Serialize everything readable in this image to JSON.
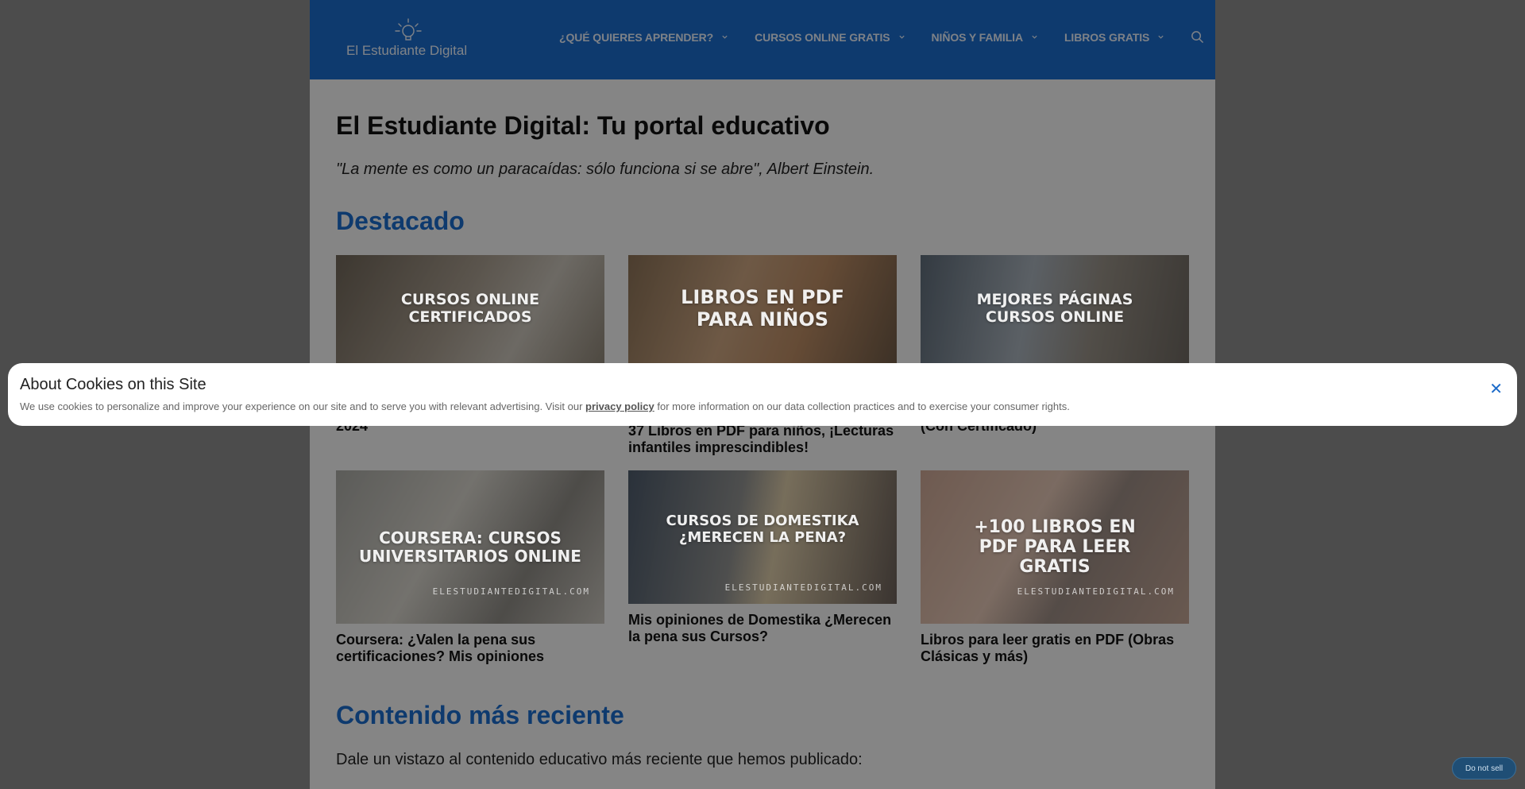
{
  "header": {
    "logo_text": "El Estudiante Digital",
    "nav": [
      {
        "label": "¿QUÉ QUIERES APRENDER?"
      },
      {
        "label": "CURSOS ONLINE GRATIS"
      },
      {
        "label": "NIÑOS Y FAMILIA"
      },
      {
        "label": "LIBROS GRATIS"
      }
    ]
  },
  "main": {
    "title": "El Estudiante Digital: Tu portal educativo",
    "quote": "\"La mente es como un paracaídas: sólo funciona si se abre\", Albert Einstein.",
    "featured_heading": "Destacado",
    "featured": [
      {
        "thumb_text": "CURSOS ONLINE CERTIFICADOS",
        "title": "2024"
      },
      {
        "thumb_text": "LIBROS EN PDF PARA NIÑOS",
        "title": "37 Libros en PDF para niños, ¡Lecturas infantiles imprescindibles!"
      },
      {
        "thumb_text": "MEJORES PÁGINAS CURSOS ONLINE",
        "title": "(Con Certificado)"
      },
      {
        "thumb_text": "COURSERA: CURSOS UNIVERSITARIOS ONLINE",
        "site": "ELESTUDIANTEDIGITAL.COM",
        "title": "Coursera: ¿Valen la pena sus certificaciones? Mis opiniones"
      },
      {
        "thumb_text": "CURSOS DE DOMESTIKA ¿MERECEN LA PENA?",
        "site": "ELESTUDIANTEDIGITAL.COM",
        "title": "Mis opiniones de Domestika ¿Merecen la pena sus Cursos?"
      },
      {
        "thumb_text": "+100 LIBROS EN PDF PARA LEER GRATIS",
        "site": "ELESTUDIANTEDIGITAL.COM",
        "title": "Libros para leer gratis en PDF (Obras Clásicas y más)"
      }
    ],
    "recent_heading": "Contenido más reciente",
    "recent_text": "Dale un vistazo al contenido educativo más reciente que hemos publicado:"
  },
  "cookie_banner": {
    "title": "About Cookies on this Site",
    "text_before": "We use cookies to personalize and improve your experience on our site and to serve you with relevant advertising. Visit our ",
    "link": "privacy policy",
    "text_after": " for more information on our data collection practices and to exercise your consumer rights.",
    "close": "✕"
  },
  "do_not_sell": "Do not sell",
  "colors": {
    "brand": "#1b6ac9",
    "background": "#f3f3f3"
  }
}
